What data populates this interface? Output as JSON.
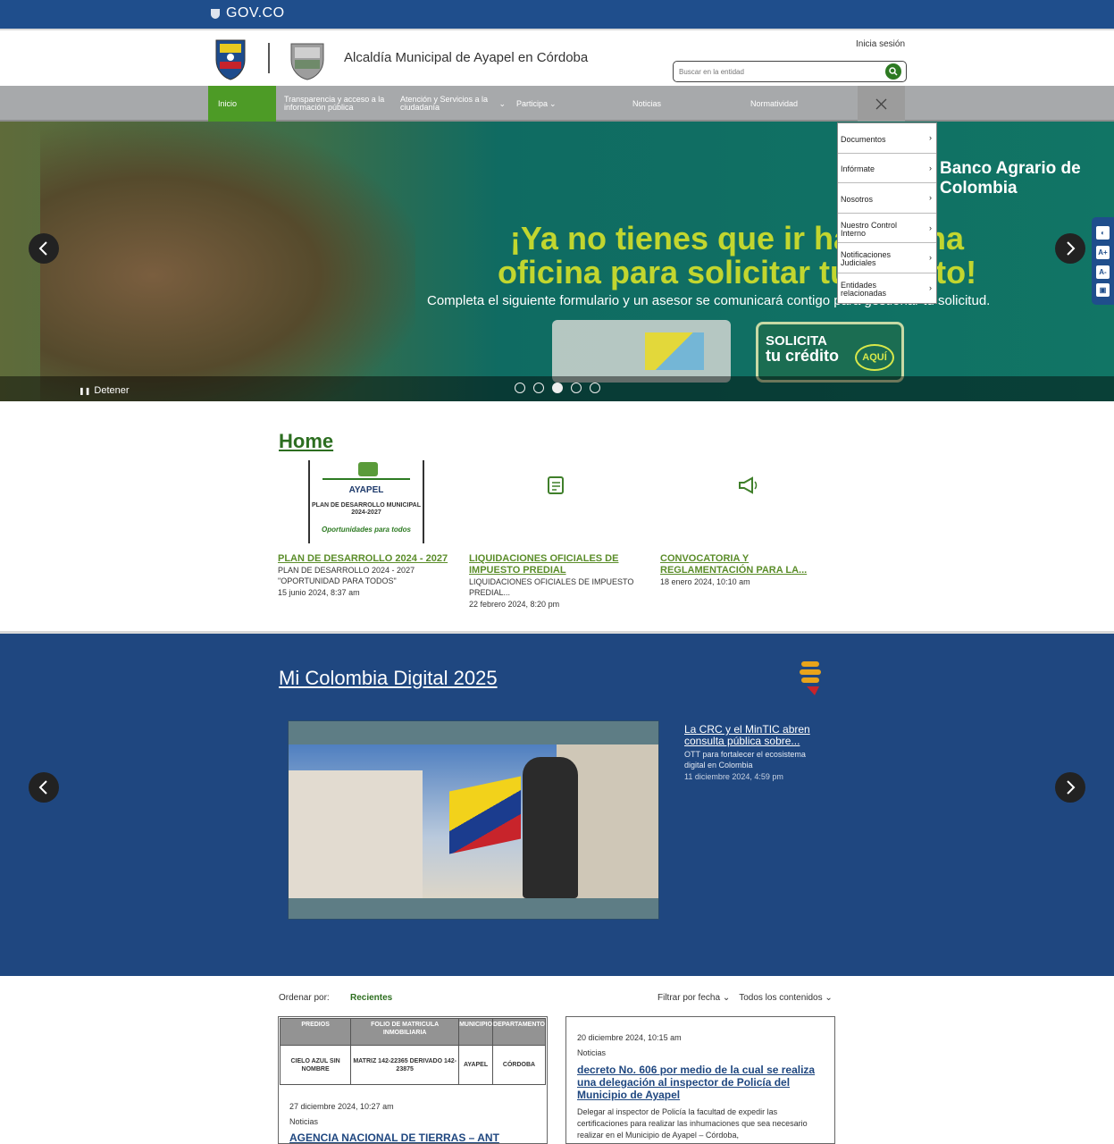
{
  "govbar": {
    "brand": "GOV.CO"
  },
  "header": {
    "site_title": "Alcaldía Municipal de Ayapel en Córdoba",
    "login": "Inicia sesión",
    "search_placeholder": "Buscar en la entidad"
  },
  "nav": {
    "items": [
      {
        "label": "Inicio"
      },
      {
        "label": "Transparencia y acceso a la información pública"
      },
      {
        "label": "Atención y Servicios a la ciudadanía"
      },
      {
        "label": "Participa"
      },
      {
        "label": "Noticias"
      },
      {
        "label": "Normatividad"
      }
    ]
  },
  "dropdown": {
    "items": [
      {
        "label": "Documentos"
      },
      {
        "label": "Infórmate"
      },
      {
        "label": "Nosotros"
      },
      {
        "label": "Nuestro Control Interno"
      },
      {
        "label": "Notificaciones Judiciales"
      },
      {
        "label": "Entidades relacionadas"
      }
    ]
  },
  "hero": {
    "headline": "¡Ya no tienes que ir hasta una oficina para solicitar tu crédito!",
    "subline": "Completa el siguiente formulario y un asesor se comunicará contigo para gestionar tu solicitud.",
    "bank": "Banco Agrario de Colombia",
    "cta_line1": "SOLICITA",
    "cta_line2": "tu crédito",
    "cta_badge": "AQUÍ",
    "stop_label": "Detener",
    "active_slide": 3,
    "slide_count": 5
  },
  "home": {
    "title": "Home",
    "cover": {
      "line1": "AYAPEL",
      "line2": "PLAN DE DESARROLLO MUNICIPAL 2024-2027",
      "line3": "Oportunidades para todos"
    },
    "cards": [
      {
        "title": "PLAN DE DESARROLLO 2024 - 2027",
        "desc": "PLAN DE DESARROLLO 2024 - 2027 \"OPORTUNIDAD PARA TODOS\"",
        "date": "15 junio 2024, 8:37 am"
      },
      {
        "title": "LIQUIDACIONES OFICIALES DE IMPUESTO PREDIAL",
        "desc": "LIQUIDACIONES OFICIALES DE IMPUESTO PREDIAL...",
        "date": "22 febrero 2024, 8:20 pm"
      },
      {
        "title": "CONVOCATORIA Y REGLAMENTACIÓN PARA LA...",
        "desc": "",
        "date": "18 enero 2024, 10:10 am"
      }
    ]
  },
  "colombia": {
    "title": "Mi Colombia Digital 2025",
    "news_title": "La CRC y el MinTIC abren consulta pública sobre...",
    "news_desc": "OTT para fortalecer el ecosistema digital en Colombia",
    "news_date": "11 diciembre 2024, 4:59 pm"
  },
  "listing": {
    "sort_label": "Ordenar por:",
    "sort_value": "Recientes",
    "filter_date": "Filtrar por fecha",
    "filter_content": "Todos los contenidos",
    "table_headers": [
      "PREDIOS",
      "FOLIO DE MATRICULA INMOBILIARIA",
      "MUNICIPIO",
      "DEPARTAMENTO"
    ],
    "table_row": [
      "CIELO AZUL SIN NOMBRE",
      "MATRIZ 142-22365 DERIVADO 142-23875",
      "AYAPEL",
      "CÓRDOBA"
    ],
    "left_date": "27 diciembre 2024, 10:27 am",
    "left_cat": "Noticias",
    "left_headline": "AGENCIA NACIONAL DE TIERRAS – ANT",
    "right_date": "20 diciembre 2024, 10:15 am",
    "right_cat": "Noticias",
    "right_headline": "decreto No. 606 por medio de la cual se realiza una delegación al inspector de Policía del Municipio de Ayapel",
    "right_body": "Delegar al inspector de Policía la facultad de expedir las certificaciones para realizar las inhumaciones que sea necesario realizar en el Municipio de Ayapel – Córdoba,"
  },
  "colors": {
    "gov_blue": "#1f4e8c",
    "nav_gray": "#a7a9ab",
    "active_green": "#4d9b26",
    "section_blue": "#1f4780"
  }
}
